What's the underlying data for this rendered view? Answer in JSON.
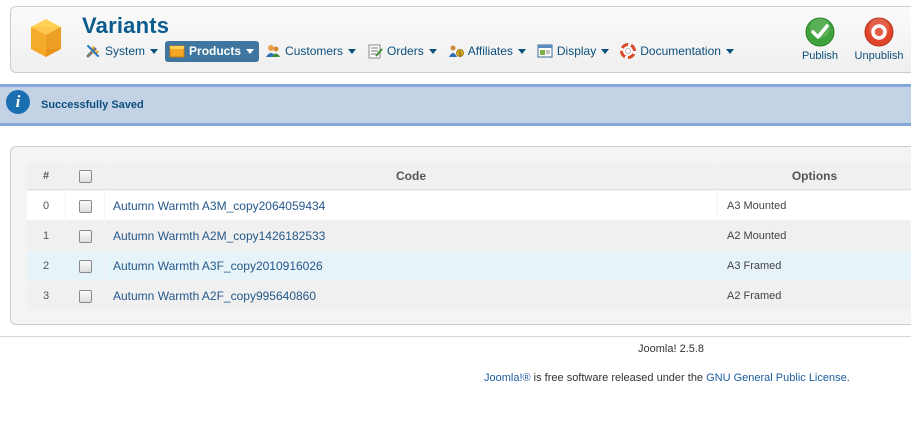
{
  "header": {
    "title": "Variants",
    "menu": [
      {
        "label": "System",
        "icon": "tools-icon",
        "active": false
      },
      {
        "label": "Products",
        "icon": "box-icon",
        "active": true
      },
      {
        "label": "Customers",
        "icon": "users-icon",
        "active": false
      },
      {
        "label": "Orders",
        "icon": "order-icon",
        "active": false
      },
      {
        "label": "Affiliates",
        "icon": "affiliate-icon",
        "active": false
      },
      {
        "label": "Display",
        "icon": "display-icon",
        "active": false
      },
      {
        "label": "Documentation",
        "icon": "lifebuoy-icon",
        "active": false
      }
    ],
    "toolbar": {
      "publish_label": "Publish",
      "unpublish_label": "Unpublish"
    }
  },
  "message": {
    "text": "Successfully Saved",
    "icon": "info-icon"
  },
  "table": {
    "headers": {
      "num": "#",
      "code": "Code",
      "options": "Options"
    },
    "rows": [
      {
        "num": "0",
        "code": "Autumn Warmth A3M_copy2064059434",
        "options": "A3 Mounted"
      },
      {
        "num": "1",
        "code": "Autumn Warmth A2M_copy1426182533",
        "options": "A2 Mounted"
      },
      {
        "num": "2",
        "code": "Autumn Warmth A3F_copy2010916026",
        "options": "A3 Framed"
      },
      {
        "num": "3",
        "code": "Autumn Warmth A2F_copy995640860",
        "options": "A2 Framed"
      }
    ]
  },
  "footer": {
    "version": "Joomla! 2.5.8",
    "license_link1": "Joomla!®",
    "license_middle": " is free software released under the ",
    "license_link2": "GNU General Public License",
    "license_end": "."
  },
  "colors": {
    "title": "#0b5b8f",
    "active_menu_bg": "#3f76a0",
    "message_bg": "#c3d2e5",
    "message_border": "#84a7db",
    "publish_green": "#3ea33a",
    "unpublish_red": "#e0442a"
  }
}
